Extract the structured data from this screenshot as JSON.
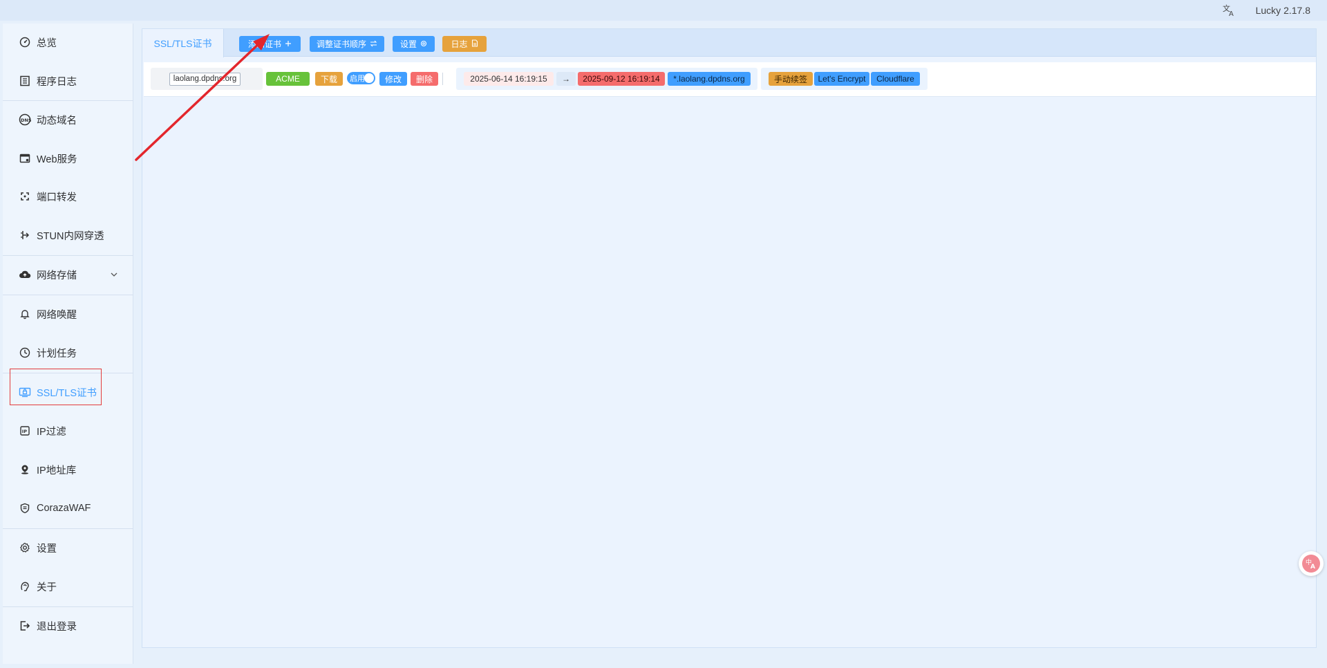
{
  "topbar": {
    "translate_icon": "translate-icon",
    "version": "Lucky 2.17.8"
  },
  "sidebar": {
    "items": [
      {
        "label": "总览",
        "icon": "dashboard-icon"
      },
      {
        "label": "程序日志",
        "icon": "log-icon"
      },
      {
        "label": "动态域名",
        "icon": "dns-icon"
      },
      {
        "label": "Web服务",
        "icon": "web-service-icon"
      },
      {
        "label": "端口转发",
        "icon": "port-forward-icon"
      },
      {
        "label": "STUN内网穿透",
        "icon": "stun-icon"
      },
      {
        "label": "网络存储",
        "icon": "cloud-storage-icon"
      },
      {
        "label": "网络唤醒",
        "icon": "bell-icon"
      },
      {
        "label": "计划任务",
        "icon": "clock-icon"
      },
      {
        "label": "SSL/TLS证书",
        "icon": "certificate-icon"
      },
      {
        "label": "IP过滤",
        "icon": "ip-filter-icon"
      },
      {
        "label": "IP地址库",
        "icon": "ip-location-icon"
      },
      {
        "label": "CorazaWAF",
        "icon": "shield-icon"
      },
      {
        "label": "设置",
        "icon": "gear-icon"
      },
      {
        "label": "关于",
        "icon": "about-icon"
      },
      {
        "label": "退出登录",
        "icon": "logout-icon"
      }
    ],
    "active": "SSL/TLS证书"
  },
  "main": {
    "tab_label": "SSL/TLS证书",
    "toolbar": {
      "add_label": "添加证书",
      "reorder_label": "调整证书顺序",
      "settings_label": "设置",
      "log_label": "日志"
    },
    "certificates": [
      {
        "remark": "laolang.dpdns.org",
        "type": "ACME",
        "download_label": "下载",
        "enabled_label": "启用",
        "enabled": true,
        "edit_label": "修改",
        "delete_label": "删除",
        "issued": "2025-06-14 16:19:15",
        "arrow": "→",
        "expires": "2025-09-12 16:19:14",
        "domain": "*.laolang.dpdns.org",
        "renew_mode": "手动续签",
        "ca": "Let's Encrypt",
        "dns_provider": "Cloudflare"
      }
    ]
  },
  "colors": {
    "accent": "#409eff",
    "success": "#67c23a",
    "warning": "#e6a23c",
    "danger": "#f56c6c",
    "annotation": "#e23b3b"
  }
}
